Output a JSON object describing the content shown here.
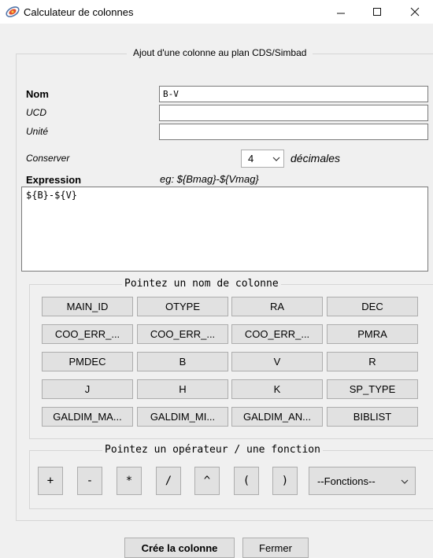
{
  "window": {
    "title": "Calculateur de colonnes"
  },
  "frame_title": "Ajout d'une colonne au plan CDS/Simbad",
  "fields": {
    "nom": {
      "label": "Nom",
      "value": "B-V"
    },
    "ucd": {
      "label": "UCD",
      "value": ""
    },
    "unite": {
      "label": "Unité",
      "value": ""
    }
  },
  "conserver": {
    "label": "Conserver",
    "value": "4",
    "suffix": "décimales"
  },
  "expression": {
    "label": "Expression",
    "example": "eg: ${Bmag}-${Vmag}",
    "value": "${B}-${V}"
  },
  "columns_group": {
    "title": "Pointez un nom de colonne",
    "columns": [
      "MAIN_ID",
      "OTYPE",
      "RA",
      "DEC",
      "COO_ERR_...",
      "COO_ERR_...",
      "COO_ERR_...",
      "PMRA",
      "PMDEC",
      "B",
      "V",
      "R",
      "J",
      "H",
      "K",
      "SP_TYPE",
      "GALDIM_MA...",
      "GALDIM_MI...",
      "GALDIM_AN...",
      "BIBLIST"
    ]
  },
  "operators_group": {
    "title": "Pointez un opérateur / une fonction",
    "operators": [
      "+",
      "-",
      "*",
      "/",
      "^",
      "(",
      ")"
    ],
    "functions_label": "--Fonctions--"
  },
  "buttons": {
    "create": "Crée la colonne",
    "close": "Fermer"
  }
}
